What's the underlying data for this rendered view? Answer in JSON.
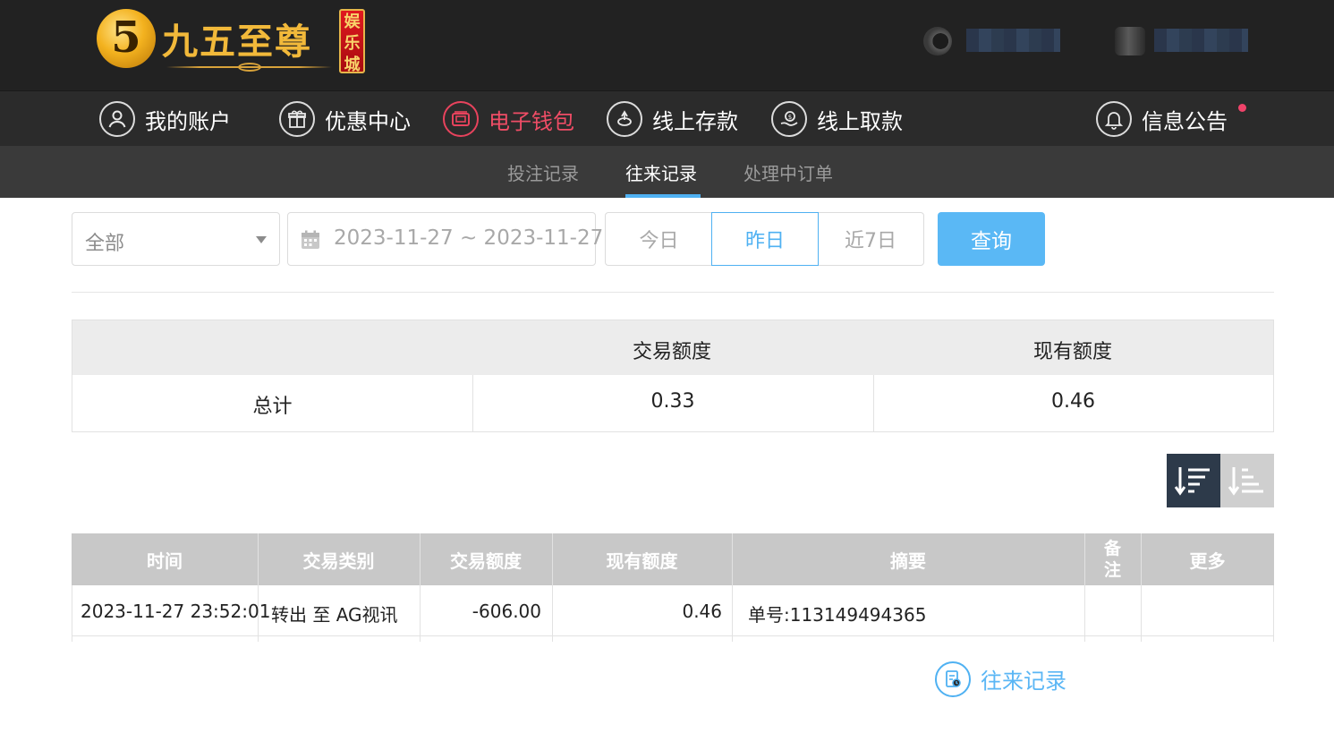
{
  "brand": {
    "logo_mark": "5",
    "name": "九五至尊",
    "badge_chars": [
      "娱",
      "乐",
      "城"
    ]
  },
  "nav": {
    "items": [
      {
        "label": "我的账户",
        "icon": "user-icon"
      },
      {
        "label": "优惠中心",
        "icon": "gift-icon"
      },
      {
        "label": "电子钱包",
        "icon": "wallet-icon"
      },
      {
        "label": "线上存款",
        "icon": "deposit-icon"
      },
      {
        "label": "线上取款",
        "icon": "withdraw-icon"
      },
      {
        "label": "往来记录",
        "icon": "records-icon"
      },
      {
        "label": "信息公告",
        "icon": "bell-icon"
      }
    ],
    "active": "往来记录",
    "highlight": "电子钱包"
  },
  "subnav": {
    "tabs": [
      "投注记录",
      "往来记录",
      "处理中订单"
    ],
    "active": "往来记录"
  },
  "filters": {
    "type_select": "全部",
    "date_range": "2023-11-27 ~ 2023-11-27",
    "quick_ranges": [
      "今日",
      "昨日",
      "近7日"
    ],
    "quick_selected": "昨日",
    "query_label": "查询"
  },
  "summary": {
    "headers": [
      "",
      "交易额度",
      "现有额度"
    ],
    "rows": [
      {
        "label": "总计",
        "trade_amount": "0.33",
        "current_amount": "0.46"
      }
    ]
  },
  "records": {
    "headers": {
      "time": "时间",
      "type": "交易类别",
      "trade_amount": "交易额度",
      "current_amount": "现有额度",
      "summary": "摘要",
      "note": "备注",
      "more": "更多"
    },
    "rows": [
      {
        "time": "2023-11-27 23:52:01",
        "type": "转出 至 AG视讯",
        "trade_amount": "-606.00",
        "current_amount": "0.46",
        "summary": "单号:113149494365",
        "note": "",
        "more": ""
      }
    ]
  },
  "colors": {
    "header_bg": "#222222",
    "nav_bg": "#2b2b2b",
    "subnav_bg": "#3a3a3a",
    "accent_blue": "#4fb1f2",
    "accent_red": "#f04d66",
    "logo_gold": "#f2b93a",
    "table_head_bg": "#c8c8c8"
  }
}
